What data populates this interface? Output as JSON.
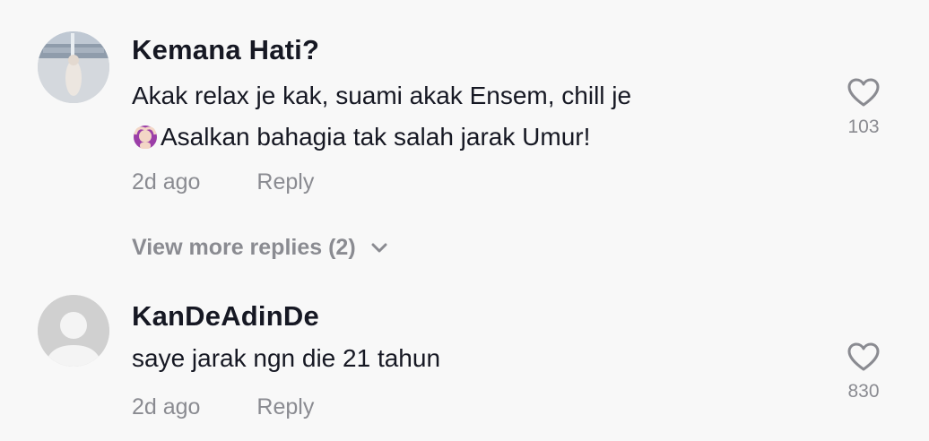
{
  "comments": [
    {
      "username": "Kemana Hati?",
      "line1": "Akak relax je kak, suami akak Ensem, chill je",
      "line2": "Asalkan bahagia tak salah jarak Umur!",
      "emoji": "🙆🏻‍♀️",
      "time": "2d ago",
      "reply_label": "Reply",
      "likes": "103",
      "avatar_icon": "user-photo-avatar"
    },
    {
      "username": "KanDeAdinDe",
      "line1": "saye jarak ngn die 21 tahun",
      "time": "2d ago",
      "reply_label": "Reply",
      "likes": "830",
      "avatar_icon": "default-user-avatar"
    }
  ],
  "view_more_replies": "View more replies (2)",
  "icons": {
    "like": "heart-outline-icon",
    "expand": "chevron-down-icon"
  },
  "colors": {
    "background": "#f8f8f8",
    "text_primary": "#161823",
    "text_secondary": "#8a8b91"
  }
}
